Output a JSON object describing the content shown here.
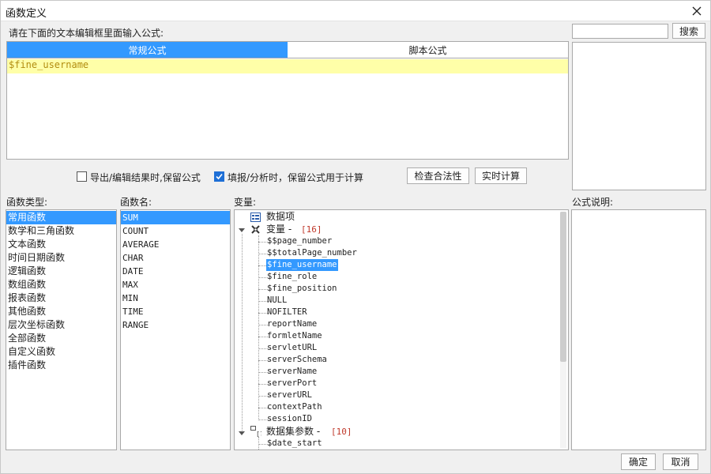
{
  "window": {
    "title": "函数定义",
    "close_icon": "close-icon"
  },
  "prompt_label": "请在下面的文本编辑框里面输入公式:",
  "search": {
    "value": "",
    "button_label": "搜索"
  },
  "formula_tabs": [
    {
      "label": "常规公式",
      "active": true
    },
    {
      "label": "脚本公式",
      "active": false
    }
  ],
  "editor": {
    "content": "$fine_username"
  },
  "options": {
    "export_keep": {
      "label": "导出/编辑结果时,保留公式",
      "checked": false
    },
    "fill_keep": {
      "label": "填报/分析时，保留公式用于计算",
      "checked": true
    },
    "check_button": "检查合法性",
    "realtime_button": "实时计算"
  },
  "function_types": {
    "label": "函数类型:",
    "items": [
      "常用函数",
      "数学和三角函数",
      "文本函数",
      "时间日期函数",
      "逻辑函数",
      "数组函数",
      "报表函数",
      "其他函数",
      "层次坐标函数",
      "全部函数",
      "自定义函数",
      "插件函数"
    ],
    "selected_index": 0
  },
  "function_names": {
    "label": "函数名:",
    "items": [
      "SUM",
      "COUNT",
      "AVERAGE",
      "CHAR",
      "DATE",
      "MAX",
      "MIN",
      "TIME",
      "RANGE"
    ],
    "selected_index": 0
  },
  "variables": {
    "label": "变量:",
    "data_item": {
      "label": "数据项",
      "icon": "data-item-icon"
    },
    "var_group": {
      "label": "变量 - ",
      "count": "[16]",
      "icon": "variable-icon",
      "items": [
        "$$page_number",
        "$$totalPage_number",
        "$fine_username",
        "$fine_role",
        "$fine_position",
        "NULL",
        "NOFILTER",
        "reportName",
        "formletName",
        "servletURL",
        "serverSchema",
        "serverName",
        "serverPort",
        "serverURL",
        "contextPath",
        "sessionID"
      ],
      "selected_index": 2
    },
    "dataset_group": {
      "label": "数据集参数 - ",
      "count": "[10]",
      "icon": "dataset-param-icon",
      "items": [
        "$date_start"
      ]
    }
  },
  "description": {
    "label": "公式说明:"
  },
  "footer": {
    "ok": "确定",
    "cancel": "取消"
  },
  "colors": {
    "accent": "#3399ff",
    "editor_highlight": "#ffffa8",
    "formula_text": "#b28c10",
    "count": "#c0392b"
  }
}
